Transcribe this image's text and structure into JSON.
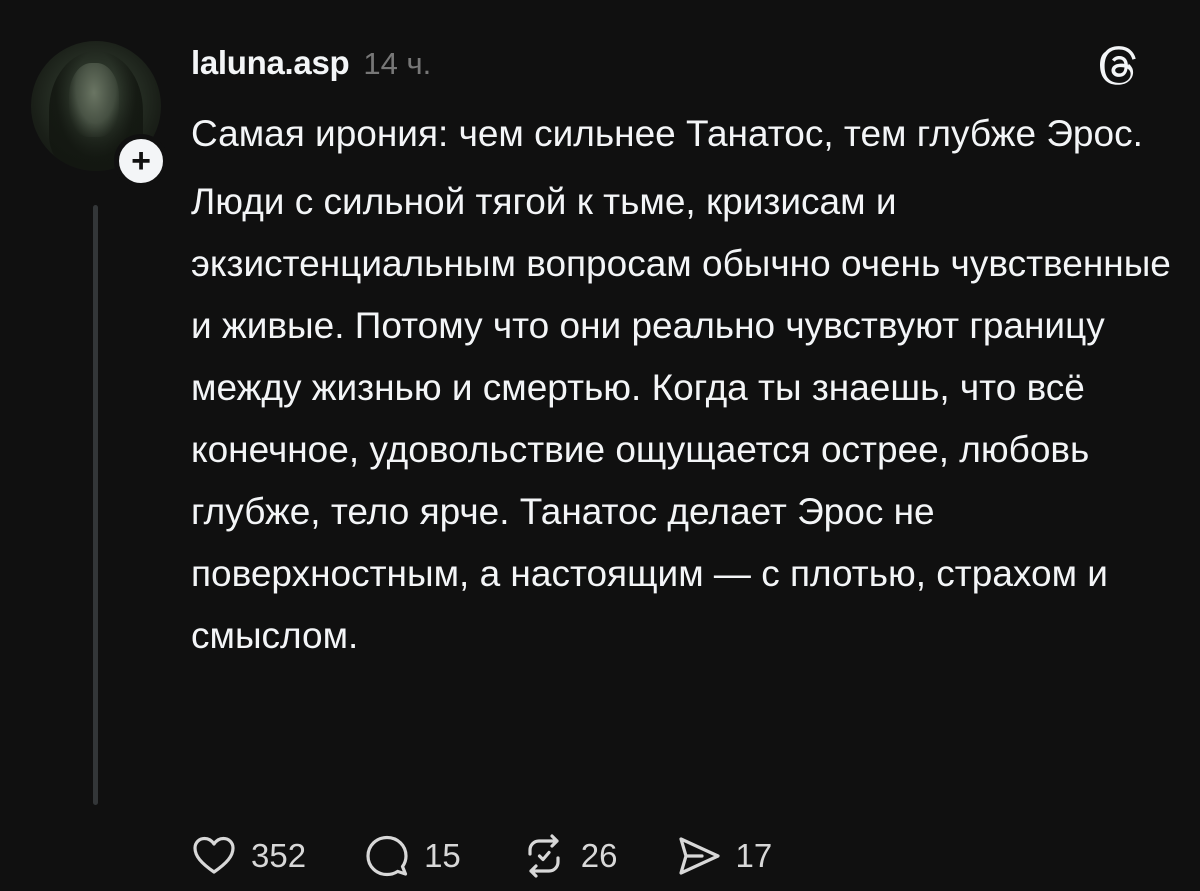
{
  "post": {
    "username": "laluna.asp",
    "time": "14 ч.",
    "follow_label": "+",
    "paragraphs": [
      "Самая ирония: чем сильнее Танатос, тем глубже Эрос.",
      "Люди с сильной тягой к тьме, кризисам и экзистенциальным вопросам обычно очень чувственные и живые. Потому что они реально чувствуют границу между жизнью и смертью. Когда ты знаешь, что всё конечное, удовольствие ощущается острее, любовь глубже, тело ярче. Танатос делает Эрос не поверхностным, а настоящим — с плотью, страхом и смыслом."
    ],
    "actions": {
      "likes": "352",
      "comments": "15",
      "reposts": "26",
      "shares": "17"
    }
  },
  "icons": {
    "like": "heart-icon",
    "comment": "comment-bubble-icon",
    "repost": "repost-icon",
    "share": "send-icon",
    "brand": "threads-logo-icon"
  },
  "colors": {
    "background": "#101010",
    "text": "#f3f5f7",
    "muted": "#777777"
  }
}
